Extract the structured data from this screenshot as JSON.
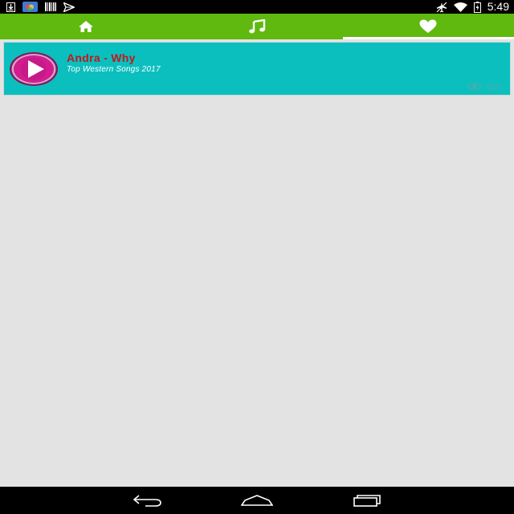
{
  "status_bar": {
    "time": "5:49",
    "left_icons": [
      "download-icon",
      "photo-app-icon",
      "barcode-icon",
      "send-icon"
    ],
    "right_icons": [
      "airplane-mode-icon",
      "wifi-icon",
      "battery-icon"
    ]
  },
  "tabs": [
    {
      "icon": "home-icon",
      "active": false
    },
    {
      "icon": "music-note-icon",
      "active": false
    },
    {
      "icon": "heart-icon",
      "active": true
    }
  ],
  "songs": [
    {
      "title": "Andra - Why",
      "subtitle": "Top Western Songs 2017",
      "views": "4221"
    }
  ],
  "nav_bar": {
    "buttons": [
      "back-icon",
      "home-icon",
      "recents-icon"
    ]
  },
  "colors": {
    "tab_bar": "#5fb90e",
    "card": "#0bbfbf",
    "title": "#c0181a",
    "background": "#e3e3e3"
  }
}
